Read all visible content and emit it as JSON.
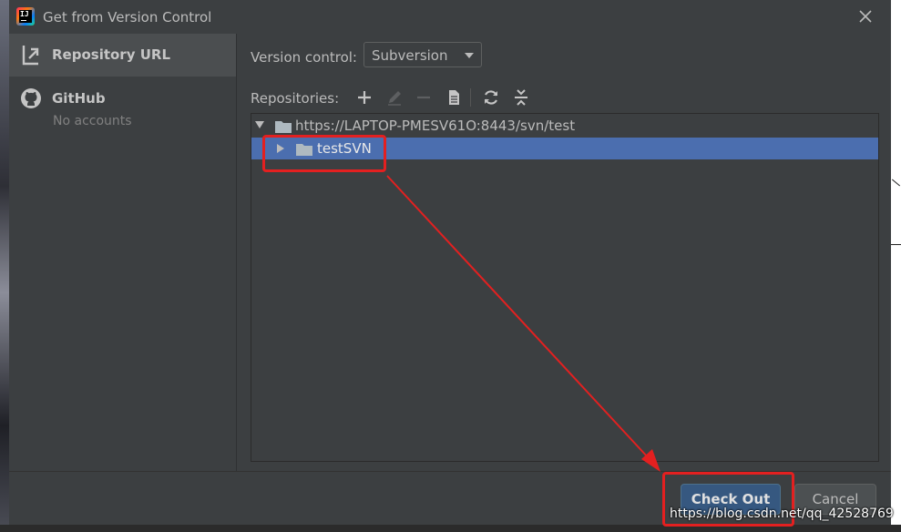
{
  "window": {
    "title": "Get from Version Control",
    "close_icon": "close-icon"
  },
  "sidebar": {
    "items": [
      {
        "label": "Repository URL",
        "icon": "vcs-repository-icon",
        "selected": true
      },
      {
        "label": "GitHub",
        "sublabel": "No accounts",
        "icon": "github-icon",
        "selected": false
      }
    ]
  },
  "main": {
    "version_control_label": "Version control:",
    "version_control_value": "Subversion",
    "repositories_label": "Repositories:",
    "toolbar": [
      "add-icon",
      "edit-icon",
      "remove-icon",
      "browse-changes-icon",
      "refresh-icon",
      "collapse-all-icon"
    ],
    "tree": {
      "root": "https://LAPTOP-PMESV61O:8443/svn/test",
      "child": "testSVN"
    }
  },
  "footer": {
    "checkout_label": "Check Out",
    "cancel_label": "Cancel"
  },
  "watermark": "https://blog.csdn.net/qq_42528769",
  "colors": {
    "selection": "#4b6eaf",
    "annotation": "#e32020",
    "primary_button": "#365880"
  }
}
